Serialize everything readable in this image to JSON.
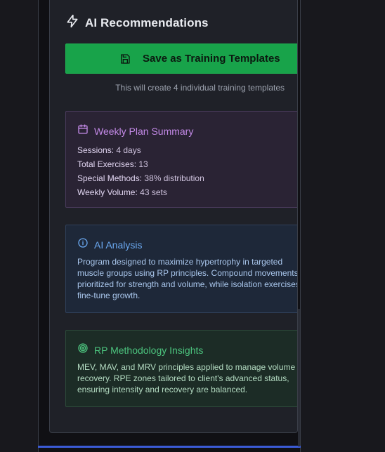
{
  "panel": {
    "title": "AI Recommendations",
    "save_button_label": "Save as Training Templates",
    "save_hint": "This will create 4 individual training templates"
  },
  "weekly_summary": {
    "title": "Weekly Plan Summary",
    "rows": [
      {
        "key": "Sessions:",
        "value": " 4 days"
      },
      {
        "key": "Total Exercises:",
        "value": " 13"
      },
      {
        "key": "Special Methods:",
        "value": " 38% distribution"
      },
      {
        "key": "Weekly Volume:",
        "value": " 43 sets"
      }
    ]
  },
  "ai_analysis": {
    "title": "AI Analysis",
    "lines": [
      "Program designed to maximize hypertrophy in targeted",
      "muscle groups using RP principles. Compound movements",
      "prioritized for strength and volume, while isolation exercises",
      "fine-tune growth."
    ]
  },
  "rp_insights": {
    "title": "RP Methodology Insights",
    "lines": [
      "MEV, MAV, and MRV principles applied to manage volume and",
      "recovery. RPE zones tailored to client's advanced status,",
      "ensuring intensity and recovery are balanced."
    ]
  },
  "colors": {
    "accent_green": "#18a34a",
    "summary_purple": "#c48ae8",
    "analysis_blue": "#6aa8f0",
    "insights_green": "#4cc47e"
  },
  "icons": {
    "header": "lightning-icon",
    "save": "floppy-disk-icon",
    "summary": "calendar-icon",
    "analysis": "info-circle-icon",
    "insights": "target-icon"
  }
}
